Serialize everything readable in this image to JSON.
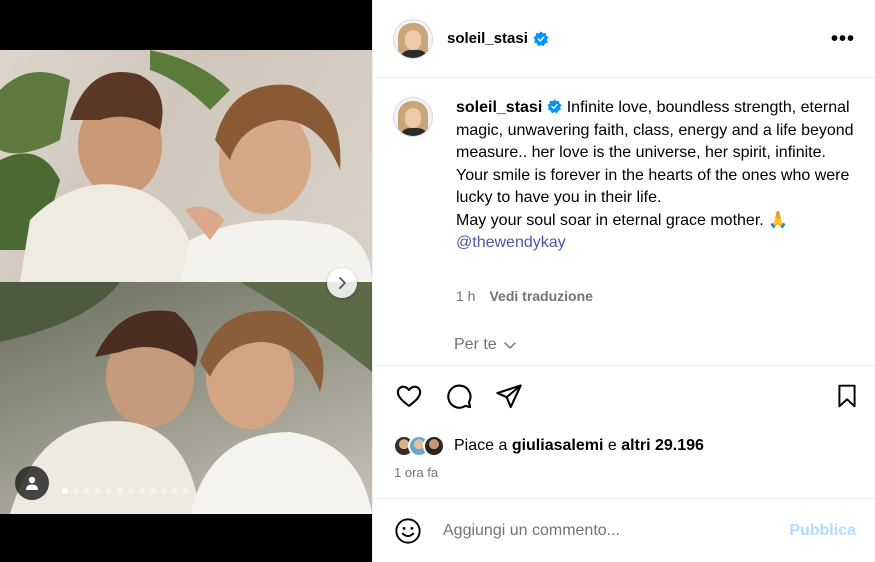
{
  "post": {
    "username": "soleil_stasi",
    "caption": "Infinite love, boundless strength, eternal magic, unwavering faith, class, energy and a life beyond measure.. her love is the universe, her spirit, infinite.",
    "caption_line2": "Your smile is forever in the hearts of the ones who were lucky to have you in their life.",
    "caption_line3": "May your soul soar in eternal grace mother. 🙏",
    "mention": "@thewendykay",
    "caption_time": "1 h",
    "translate_label": "Vedi traduzione",
    "for_you_label": "Per te",
    "likes_prefix": "Piace a ",
    "likes_user": "giuliasalemi",
    "likes_middle": " e ",
    "likes_count": "altri 29.196",
    "post_time": "1 ora fa",
    "comment_placeholder": "Aggiungi un commento...",
    "publish_label": "Pubblica",
    "more_label": "•••"
  },
  "carousel": {
    "total_slides": 12,
    "active_index": 1
  },
  "icons": {
    "verified": "verified-badge-icon",
    "like": "heart-icon",
    "comment": "comment-icon",
    "share": "paper-plane-icon",
    "save": "bookmark-icon",
    "tag": "person-icon",
    "next": "chevron-right-icon",
    "emoji": "emoji-icon",
    "dropdown": "chevron-down-icon"
  },
  "colors": {
    "verified": "#0095f6",
    "mention": "#4a5aa8",
    "secondary_text": "#737373",
    "publish_disabled": "#b3dbff"
  }
}
